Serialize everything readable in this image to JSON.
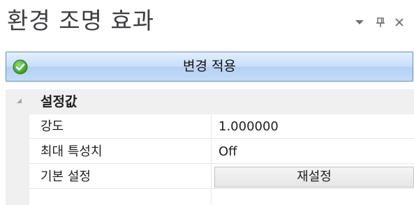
{
  "panel": {
    "title": "환경 조명 효과",
    "controls": {
      "dropdown_icon": "dropdown-arrow-icon",
      "pin_icon": "pin-icon",
      "close_icon": "close-icon",
      "pin_glyph": "ꟼ",
      "close_glyph": "×"
    }
  },
  "apply": {
    "label": "변경 적용",
    "icon": "check-circle-icon",
    "icon_color": "#3aa02a"
  },
  "properties": {
    "category": {
      "label": "설정값",
      "expander_icon": "collapse-triangle-icon"
    },
    "rows": [
      {
        "name": "강도",
        "value": "1.000000"
      },
      {
        "name": "최대 특성치",
        "value": "Off"
      },
      {
        "name": "기본 설정",
        "button_label": "재설정"
      }
    ]
  }
}
